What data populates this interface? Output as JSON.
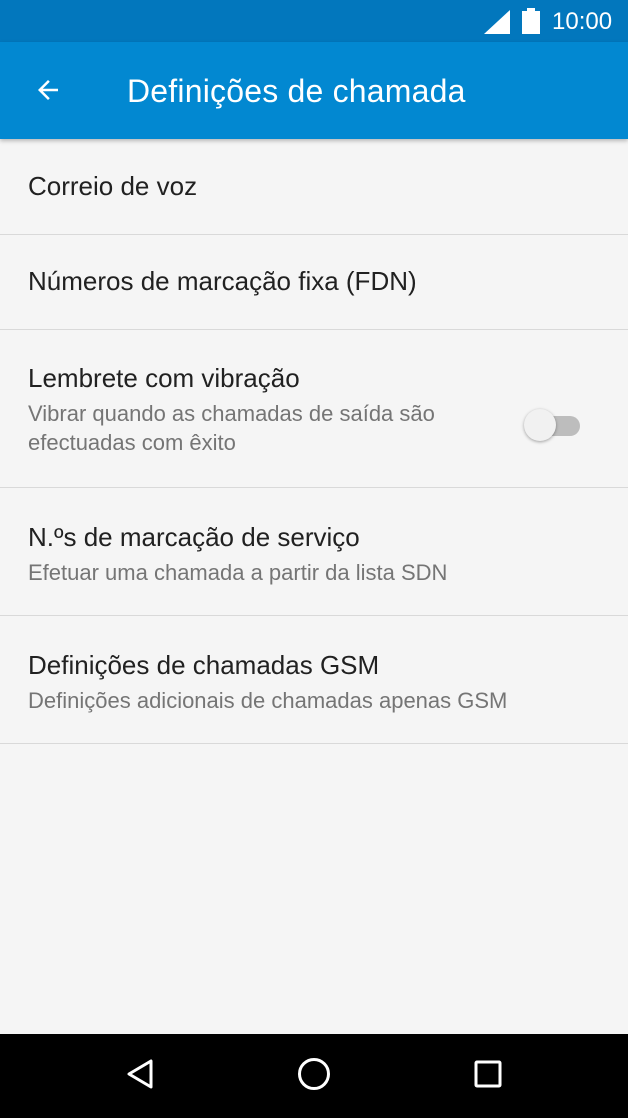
{
  "status_bar": {
    "time": "10:00",
    "icons": [
      "signal-icon",
      "battery-icon"
    ]
  },
  "app_bar": {
    "back_icon": "arrow-back-icon",
    "title": "Definições de chamada"
  },
  "settings": [
    {
      "title": "Correio de voz"
    },
    {
      "title": "Números de marcação fixa (FDN)"
    },
    {
      "title": "Lembrete com vibração",
      "summary_line1": "Vibrar quando as chamadas de saída são",
      "summary_line2": "efectuadas com êxito",
      "toggle": "off"
    },
    {
      "title": "N.ºs de marcação de serviço",
      "summary": "Efetuar uma chamada a partir da lista SDN"
    },
    {
      "title": "Definições de chamadas GSM",
      "summary": "Definições adicionais de chamadas apenas GSM"
    }
  ],
  "nav_bar": {
    "icons": [
      "back-triangle-icon",
      "home-circle-icon",
      "recents-square-icon"
    ]
  },
  "colors": {
    "status_bar": "#0277bd",
    "app_bar": "#0288d1",
    "background": "#f5f5f5",
    "primary_text": "#212121",
    "secondary_text": "#757575"
  }
}
